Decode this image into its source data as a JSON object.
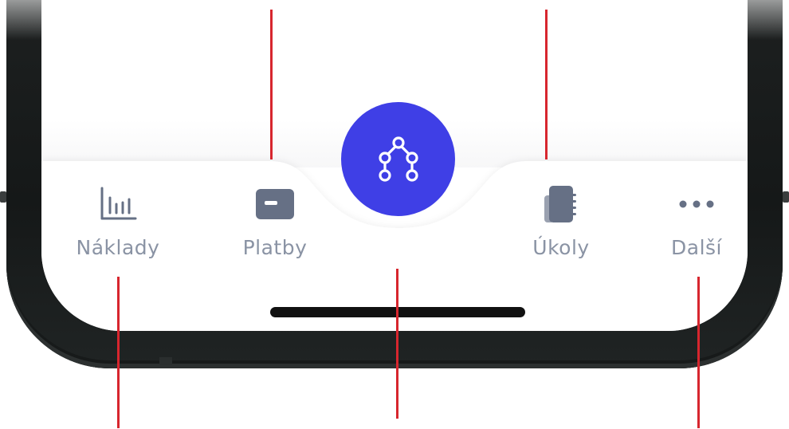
{
  "tabbar": {
    "tabs": [
      {
        "label": "Náklady",
        "icon": "bar-chart-icon"
      },
      {
        "label": "Platby",
        "icon": "card-icon"
      },
      {
        "label": "Úkoly",
        "icon": "notebook-icon"
      },
      {
        "label": "Další",
        "icon": "more-dots-icon"
      }
    ],
    "center_action": {
      "icon": "workflow-icon"
    }
  },
  "colors": {
    "accent": "#3f3fe6",
    "tab_label": "#8a93a4",
    "icon": "#667085",
    "callout": "#d7262e",
    "frame": "#1a1d1d"
  }
}
